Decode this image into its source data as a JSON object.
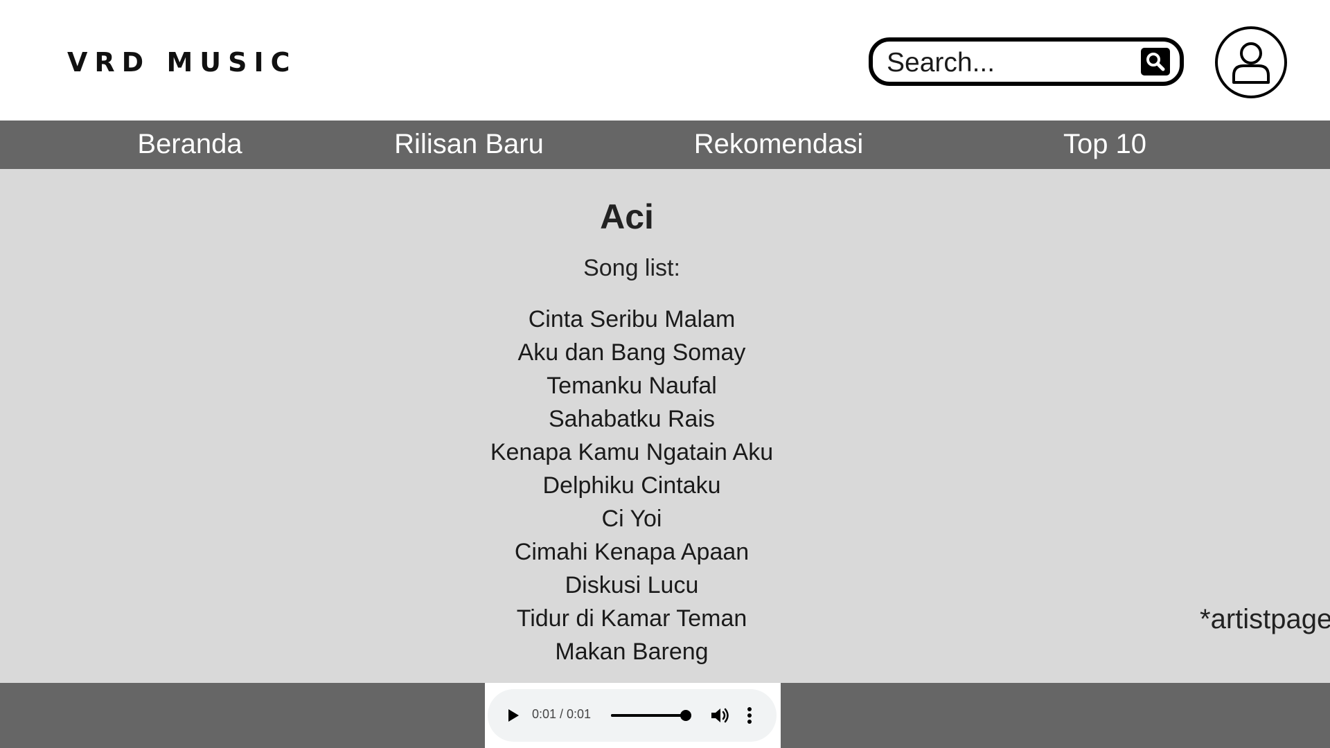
{
  "header": {
    "logo": "VRD MUSIC",
    "search": {
      "placeholder": "Search..."
    }
  },
  "nav": {
    "items": [
      {
        "label": "Beranda"
      },
      {
        "label": "Rilisan Baru"
      },
      {
        "label": "Rekomendasi"
      },
      {
        "label": "Top 10"
      }
    ]
  },
  "main": {
    "artist_name": "Aci",
    "song_list_label": "Song list:",
    "songs": [
      "Cinta Seribu Malam",
      "Aku dan Bang Somay",
      "Temanku Naufal",
      "Sahabatku Rais",
      "Kenapa Kamu Ngatain Aku",
      "Delphiku Cintaku",
      "Ci Yoi",
      "Cimahi Kenapa Apaan",
      "Diskusi Lucu",
      "Tidur di Kamar Teman",
      "Makan Bareng"
    ],
    "page_note": "*artistpage"
  },
  "player": {
    "time_display": "0:01 / 0:01",
    "progress_fraction": 1.0
  },
  "colors": {
    "nav_bg": "#666666",
    "main_bg": "#d9d9d9",
    "player_bg": "#f1f3f4"
  },
  "icons": {
    "search": "search-icon",
    "user": "user-icon",
    "play": "play-icon",
    "volume": "volume-icon",
    "more": "more-vertical-icon"
  }
}
